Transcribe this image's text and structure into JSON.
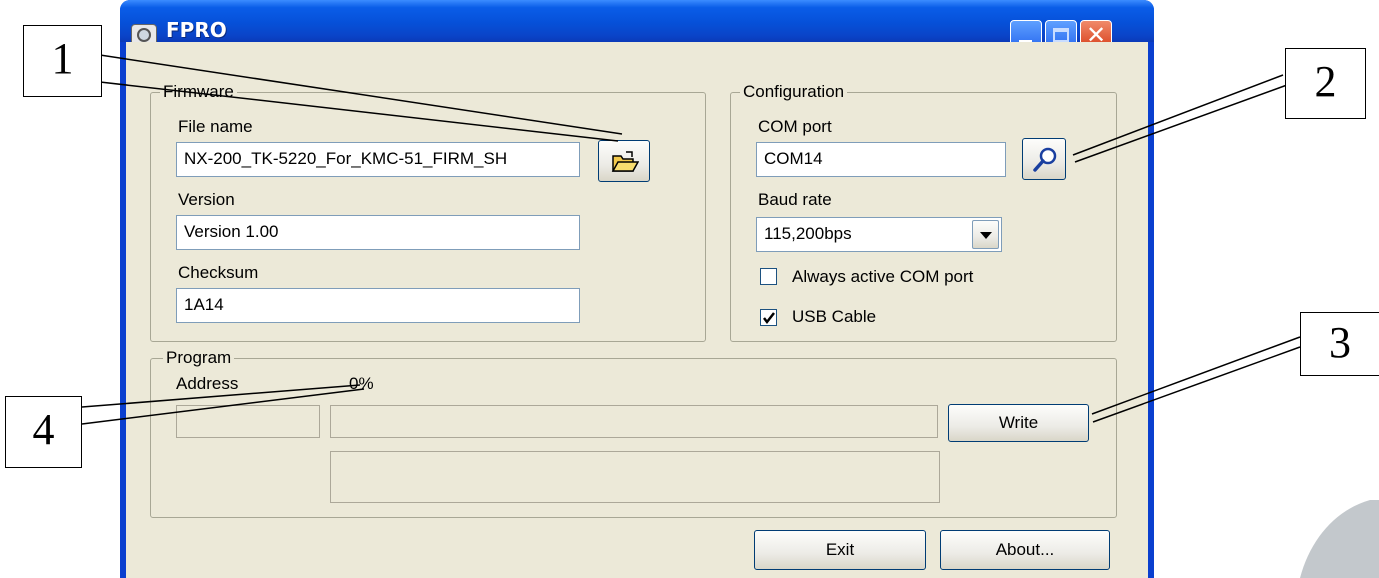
{
  "window": {
    "title": "FPRO"
  },
  "firmware": {
    "group_label": "Firmware",
    "file_name_label": "File name",
    "file_name_value": "NX-200_TK-5220_For_KMC-51_FIRM_SH",
    "version_label": "Version",
    "version_value": "Version 1.00",
    "checksum_label": "Checksum",
    "checksum_value": "1A14",
    "open_icon": "open-folder-icon"
  },
  "configuration": {
    "group_label": "Configuration",
    "com_port_label": "COM port",
    "com_port_value": "COM14",
    "search_icon": "magnifier-icon",
    "baud_rate_label": "Baud rate",
    "baud_rate_value": "115,200bps",
    "always_active_label": "Always active COM port",
    "always_active_checked": false,
    "usb_cable_label": "USB Cable",
    "usb_cable_checked": true
  },
  "program": {
    "group_label": "Program",
    "address_label": "Address",
    "percent_text": "0%",
    "progress": 0,
    "write_label": "Write"
  },
  "footer": {
    "exit_label": "Exit",
    "about_label": "About..."
  },
  "annotations": [
    {
      "label": "1"
    },
    {
      "label": "2"
    },
    {
      "label": "3"
    },
    {
      "label": "4"
    }
  ],
  "colors": {
    "titlebar": "#0650d8",
    "dialog_face": "#ece9d8",
    "close_button": "#d8401c"
  }
}
